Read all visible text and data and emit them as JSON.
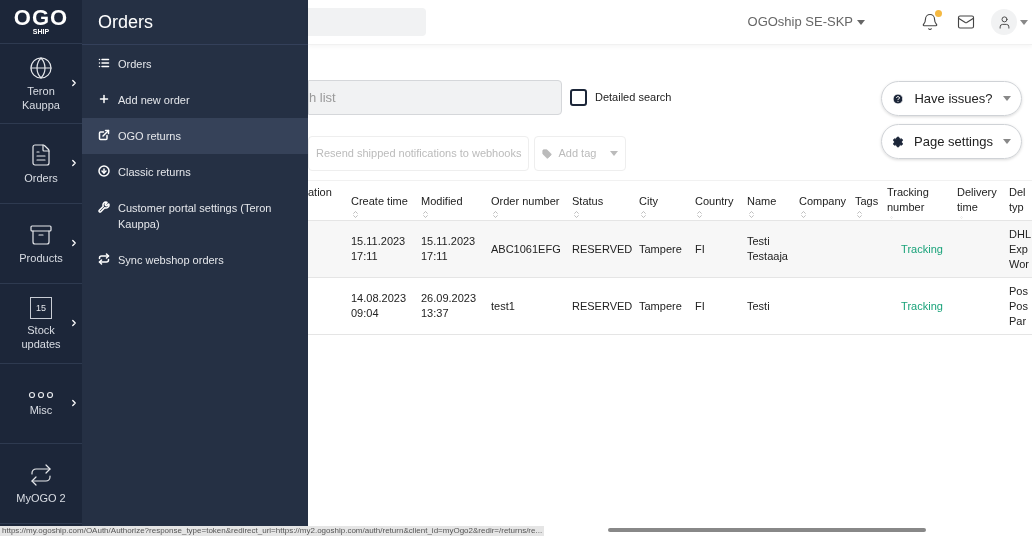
{
  "logo": {
    "text": "OGO",
    "sub": "SHIP"
  },
  "rail": [
    {
      "label": "Teron Kauppa"
    },
    {
      "label": "Orders"
    },
    {
      "label": "Products"
    },
    {
      "label": "Stock updates",
      "icon_text": "15"
    },
    {
      "label": "Misc"
    },
    {
      "label": "MyOGO 2"
    }
  ],
  "flyout": {
    "title": "Orders",
    "items": [
      {
        "label": "Orders",
        "selected": false
      },
      {
        "label": "Add new order",
        "selected": false
      },
      {
        "label": "OGO returns",
        "selected": true
      },
      {
        "label": "Classic returns",
        "selected": false
      },
      {
        "label": "Customer portal settings (Teron Kauppa)",
        "selected": false
      },
      {
        "label": "Sync webshop orders",
        "selected": false
      }
    ]
  },
  "header": {
    "account": "OGOship SE-SKP",
    "notification": true
  },
  "search": {
    "placeholder": "h list"
  },
  "detailed_search": {
    "label": "Detailed search",
    "checked": false
  },
  "side_buttons": [
    {
      "label": "Have issues?"
    },
    {
      "label": "Page settings"
    }
  ],
  "toolbar": [
    {
      "label": "Resend shipped notifications to webhooks",
      "kind": "plain",
      "disabled": true
    },
    {
      "label": "Add tag",
      "kind": "tag",
      "disabled": true
    }
  ],
  "table": {
    "columns": [
      {
        "label": "ation",
        "sortable": false
      },
      {
        "label": "Create time",
        "sortable": true
      },
      {
        "label": "Modified",
        "sortable": true
      },
      {
        "label": "Order number",
        "sortable": true
      },
      {
        "label": "Status",
        "sortable": true
      },
      {
        "label": "City",
        "sortable": true
      },
      {
        "label": "Country",
        "sortable": true
      },
      {
        "label": "Name",
        "sortable": true
      },
      {
        "label": "Company",
        "sortable": true
      },
      {
        "label": "Tags",
        "sortable": true
      },
      {
        "label": "Tracking number",
        "sortable": true
      },
      {
        "label": "Delivery time",
        "sortable": true
      },
      {
        "label": "Del\ntyp",
        "sortable": false
      }
    ],
    "rows": [
      {
        "cells": [
          "",
          "15.11.2023\n17:11",
          "15.11.2023\n17:11",
          "ABC1061EFG",
          "RESERVED",
          "Tampere",
          "FI",
          "Testi\nTestaaja",
          "",
          "",
          "Tracking",
          "",
          "DHL\nExp\nWor"
        ]
      },
      {
        "cells": [
          "",
          "14.08.2023\n09:04",
          "26.09.2023\n13:37",
          "test1",
          "RESERVED",
          "Tampere",
          "FI",
          "Testi",
          "",
          "",
          "Tracking",
          "",
          "Pos\nPos\nPar"
        ]
      }
    ]
  },
  "status_url": "https://my.ogoship.com/OAuth/Authorize?response_type=token&redirect_uri=https://my2.ogoship.com/auth/return&client_id=myOgo2&redir=/returns/re..."
}
